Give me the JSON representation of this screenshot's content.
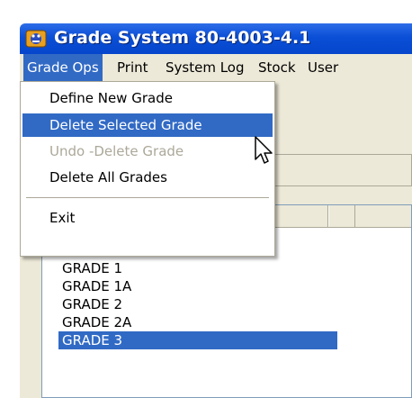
{
  "window": {
    "title": "Grade System 80-4003-4.1",
    "icon": "app-icon"
  },
  "menubar": {
    "items": [
      {
        "label": "Grade Ops",
        "open": true
      },
      {
        "label": "Print"
      },
      {
        "label": "System Log"
      },
      {
        "label": "Stock"
      },
      {
        "label": "User"
      }
    ]
  },
  "dropdown": {
    "items": [
      {
        "label": "Define New  Grade",
        "state": "normal"
      },
      {
        "label": "Delete Selected  Grade",
        "state": "highlighted"
      },
      {
        "label": "Undo -Delete Grade",
        "state": "disabled"
      },
      {
        "label": "Delete All  Grades",
        "state": "normal"
      },
      {
        "label": "Exit",
        "state": "normal"
      }
    ]
  },
  "grade_list": {
    "rows": [
      "GRADE 1",
      "GRADE 1A",
      "GRADE 2",
      "GRADE 2A",
      "GRADE 3"
    ],
    "selected": "GRADE 3"
  },
  "colors": {
    "title_bar": "#0a4fd6",
    "highlight": "#316ac5",
    "menu_bg": "#ece9d8",
    "disabled_text": "#aca899"
  }
}
